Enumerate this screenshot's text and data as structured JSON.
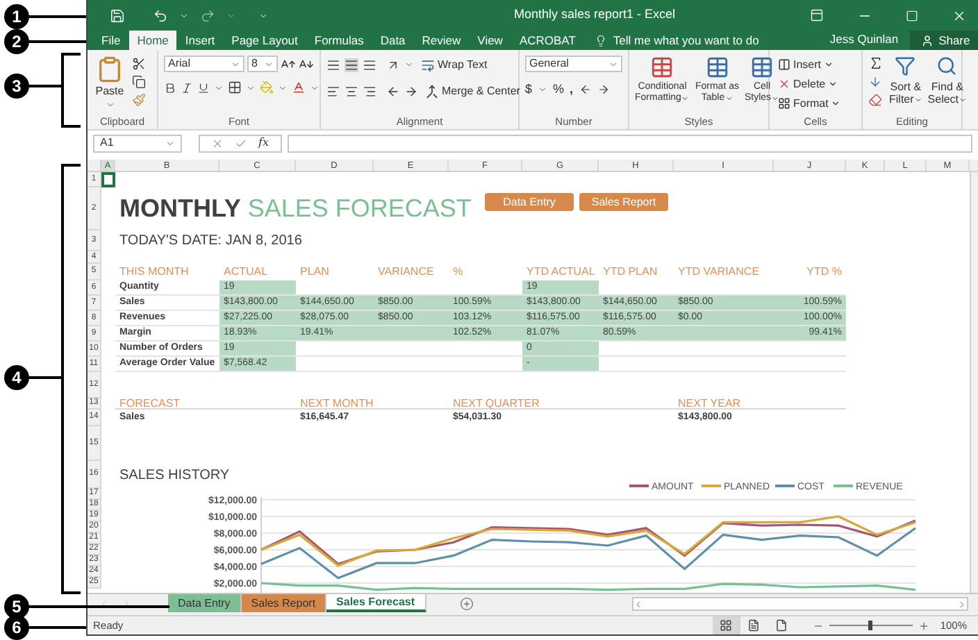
{
  "callouts": [
    {
      "label": "1",
      "kind": "line"
    },
    {
      "label": "2",
      "kind": "line"
    },
    {
      "label": "3",
      "kind": "bracket"
    },
    {
      "label": "4",
      "kind": "bracket"
    },
    {
      "label": "5",
      "kind": "line"
    },
    {
      "label": "6",
      "kind": "line"
    }
  ],
  "title_bar": {
    "title": "Monthly sales report1 - Excel"
  },
  "menu_tabs": [
    {
      "label": "File",
      "selected": false
    },
    {
      "label": "Home",
      "selected": true
    },
    {
      "label": "Insert",
      "selected": false
    },
    {
      "label": "Page Layout",
      "selected": false
    },
    {
      "label": "Formulas",
      "selected": false
    },
    {
      "label": "Data",
      "selected": false
    },
    {
      "label": "Review",
      "selected": false
    },
    {
      "label": "View",
      "selected": false
    },
    {
      "label": "ACROBAT",
      "selected": false
    }
  ],
  "tell_me": {
    "placeholder": "Tell me what you want to do"
  },
  "user": "Jess Quinlan",
  "share": "Share",
  "ribbon": {
    "clipboard": {
      "label": "Clipboard",
      "paste": "Paste"
    },
    "font": {
      "label": "Font",
      "family": "Arial",
      "size": "8"
    },
    "alignment": {
      "label": "Alignment",
      "wrap": "Wrap Text",
      "merge": "Merge & Center"
    },
    "number": {
      "label": "Number",
      "format": "General",
      "currency": "$",
      "percent": "%",
      "comma": ","
    },
    "styles": {
      "label": "Styles",
      "buttons": [
        {
          "line1": "Conditional",
          "line2": "Formatting"
        },
        {
          "line1": "Format as",
          "line2": "Table"
        },
        {
          "line1": "Cell",
          "line2": "Styles"
        }
      ]
    },
    "cells": {
      "label": "Cells",
      "buttons": [
        "Insert",
        "Delete",
        "Format"
      ]
    },
    "editing": {
      "label": "Editing",
      "buttons": [
        {
          "line1": "Sort &",
          "line2": "Filter"
        },
        {
          "line1": "Find &",
          "line2": "Select"
        }
      ]
    }
  },
  "formula_bar": {
    "name_box": "A1",
    "fx": "fx"
  },
  "columns": [
    "A",
    "B",
    "C",
    "D",
    "E",
    "F",
    "G",
    "H",
    "I",
    "J",
    "K",
    "L",
    "M"
  ],
  "row_numbers": [
    "1",
    "2",
    "3",
    "4",
    "5",
    "6",
    "7",
    "8",
    "9",
    "10",
    "11",
    "12",
    "13",
    "14",
    "15",
    "16",
    "17",
    "18",
    "19",
    "20",
    "21",
    "22",
    "23",
    "24",
    "25"
  ],
  "sheet": {
    "title_bold": "MONTHLY",
    "title_rest": "SALES FORECAST",
    "date": "TODAY'S DATE: JAN 8, 2016",
    "buttons": [
      {
        "label": "Data Entry"
      },
      {
        "label": "Sales Report"
      }
    ],
    "headers": {
      "label": "THIS MONTH",
      "actual": "ACTUAL",
      "plan": "PLAN",
      "variance": "VARIANCE",
      "pct": "%",
      "ytd_actual": "YTD ACTUAL",
      "ytd_plan": "YTD PLAN",
      "ytd_variance": "YTD VARIANCE",
      "ytd_pct": "YTD %"
    },
    "metrics": [
      {
        "label": "Quantity",
        "shaded": false,
        "actual": "19",
        "ytd_actual": "19"
      },
      {
        "label": "Sales",
        "shaded": true,
        "actual": "$143,800.00",
        "plan": "$144,650.00",
        "variance": "$850.00",
        "pct": "100.59%",
        "ytd_actual": "$143,800.00",
        "ytd_plan": "$144,650.00",
        "ytd_variance": "$850.00",
        "ytd_pct": "100.59%"
      },
      {
        "label": "Revenues",
        "shaded": true,
        "actual": "$27,225.00",
        "plan": "$28,075.00",
        "variance": "$850.00",
        "pct": "103.12%",
        "ytd_actual": "$116,575.00",
        "ytd_plan": "$116,575.00",
        "ytd_variance": "$0.00",
        "ytd_pct": "100.00%"
      },
      {
        "label": "Margin",
        "shaded": true,
        "actual": "18.93%",
        "plan": "19.41%",
        "pct": "102.52%",
        "ytd_actual": "81.07%",
        "ytd_plan": "80.59%",
        "ytd_pct": "99.41%"
      },
      {
        "label": "Number of Orders",
        "shaded": false,
        "actual": "19",
        "ytd_actual": "0"
      },
      {
        "label": "Average Order Value",
        "shaded": false,
        "actual": "$7,568.42",
        "ytd_actual": "-"
      }
    ],
    "forecast": {
      "headers": {
        "label": "FORECAST",
        "next_month": "NEXT MONTH",
        "next_quarter": "NEXT QUARTER",
        "next_year": "NEXT YEAR"
      },
      "row": {
        "label": "Sales",
        "next_month": "$16,645.47",
        "next_quarter": "$54,031.30",
        "next_year": "$143,800.00"
      }
    },
    "chart_data": {
      "type": "line",
      "title": "SALES HISTORY",
      "ylim": [
        1000,
        12000
      ],
      "grid": true,
      "legend": true,
      "yticks": [
        {
          "value": 2000,
          "label": "$2,000.00"
        },
        {
          "value": 4000,
          "label": "$4,000.00"
        },
        {
          "value": 6000,
          "label": "$6,000.00"
        },
        {
          "value": 8000,
          "label": "$8,000.00"
        },
        {
          "value": 10000,
          "label": "$10,000.00"
        },
        {
          "value": 12000,
          "label": "$12,000.00"
        }
      ],
      "series": [
        {
          "name": "AMOUNT",
          "color": "#a8566c",
          "values": [
            6000,
            8200,
            4300,
            5800,
            6000,
            6900,
            8700,
            8600,
            8500,
            7800,
            8600,
            5300,
            9200,
            8900,
            9000,
            8900,
            7600,
            9500
          ]
        },
        {
          "name": "PLANNED",
          "color": "#d9a83a",
          "values": [
            6000,
            7800,
            4100,
            5900,
            6000,
            7400,
            8500,
            8400,
            8300,
            7600,
            8300,
            5500,
            9300,
            9300,
            9300,
            10000,
            7800,
            9300
          ]
        },
        {
          "name": "COST",
          "color": "#5f8fa9",
          "values": [
            4300,
            6200,
            2600,
            4400,
            4400,
            5300,
            7200,
            7000,
            6900,
            6500,
            7700,
            3700,
            7800,
            7200,
            7700,
            7500,
            5300,
            8600
          ]
        },
        {
          "name": "REVENUE",
          "color": "#74c193",
          "values": [
            2000,
            1700,
            1700,
            1200,
            1400,
            1300,
            1300,
            1300,
            1300,
            1200,
            1300,
            1300,
            1900,
            1800,
            1500,
            1600,
            1700,
            1200
          ]
        }
      ]
    }
  },
  "sheet_tabs": [
    {
      "label": "Data Entry",
      "selected": false,
      "color": "#7fbd95"
    },
    {
      "label": "Sales Report",
      "selected": false,
      "color": "#d4884c"
    },
    {
      "label": "Sales Forecast",
      "selected": true,
      "color": "#ffffff"
    }
  ],
  "status_bar": {
    "text": "Ready",
    "views": [
      {
        "kind": "normal",
        "selected": true
      },
      {
        "kind": "page_layout",
        "selected": false
      },
      {
        "kind": "page_break",
        "selected": false
      }
    ],
    "zoom": {
      "level": 0.5,
      "reading": "100%"
    }
  }
}
